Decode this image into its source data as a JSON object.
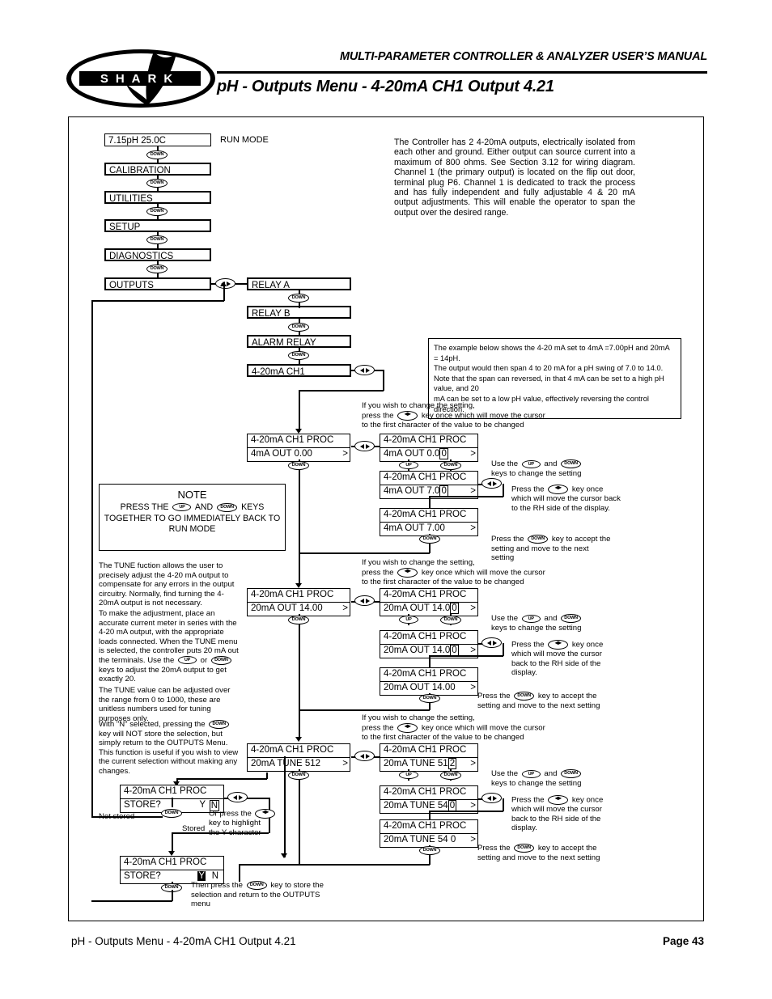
{
  "header": {
    "logo_text": "SHARK",
    "title": "MULTI-PARAMETER CONTROLLER & ANALYZER USER’S MANUAL",
    "subtitle": "pH - Outputs Menu - 4-20mA CH1 Output 4.21"
  },
  "footer": {
    "left": "pH - Outputs Menu - 4-20mA CH1 Output 4.21",
    "right": "Page 43"
  },
  "keys": {
    "down": "DOWN",
    "up": "UP",
    "leftright": "◄►"
  },
  "menu": {
    "run_mode_label": "RUN MODE",
    "items": [
      {
        "label": "7.15pH  25.0C"
      },
      {
        "label": "CALIBRATION"
      },
      {
        "label": "UTILITIES"
      },
      {
        "label": "SETUP"
      },
      {
        "label": "DIAGNOSTICS"
      },
      {
        "label": "OUTPUTS"
      }
    ]
  },
  "outputs_submenu": [
    {
      "label": "RELAY A"
    },
    {
      "label": "RELAY B"
    },
    {
      "label": "ALARM RELAY"
    },
    {
      "label": "4-20mA CH1"
    }
  ],
  "intro_text": "The Controller has 2 4-20mA outputs, electrically isolated from each other and ground. Either output can source current into a maximum of 800 ohms. See Section 3.12 for wiring diagram. Channel 1 (the primary output) is located on the flip out door, terminal plug P6. Channel 1 is dedicated to track the process and has fully independent and fully adjustable 4 & 20 mA output adjustments. This will enable the operator to span the output over the desired range.",
  "example_box": {
    "line1": "The example below shows the 4-20 mA set to 4mA =7.00pH and 20mA = 14pH.",
    "line2": "The output would then span 4 to 20 mA for a pH swing of 7.0 to 14.0.",
    "line3": "Note that the span can reversed, in that 4 mA can be set to a high pH value, and 20",
    "line4": "mA can be set to a low pH value, effectively reversing the control direction."
  },
  "note_box": {
    "title": "NOTE",
    "l1a": "PRESS THE",
    "l1b": "AND",
    "l1c": "KEYS",
    "l2": "TOGETHER TO GO IMMEDIATELY BACK TO",
    "l3": "RUN MODE"
  },
  "tune_text": {
    "p1": "The TUNE fuction allows the user to precisely adjust the 4-20 mA output to compensate for any errors in the output circuitry. Normally, find turning the 4-20mA output is not necessary.",
    "p2a": "To make the adjustment, place an accurate current meter in series with the 4-20 mA output, with the appropriate loads connected. When the TUNE menu is selected, the controller puts 20 mA out the terminals. Use the",
    "p2b": "or",
    "p2c": "keys to adjust the 20mA output to get exactly 20.",
    "p3": "The TUNE value can be adjusted over the range from 0 to 1000, these are unitless numbers used for tuning purposes only.",
    "p4a": "With \"N\" selected, pressing the",
    "p4b": "key will NOT store the selection, but simply return to the OUTPUTS Menu. This function is useful if you wish to view the current selection without making any changes."
  },
  "change_hint": {
    "l1": "If you wish to change the setting,",
    "l2a": "press the",
    "l2b": "key once which will move the cursor",
    "l3": "to the first character of the value to be changed"
  },
  "use_updown_hint": {
    "a": "Use the",
    "b": "and",
    "c": "keys to change the setting"
  },
  "press_lr_hint": {
    "a": "Press the",
    "b": "key once",
    "l2": "which will move the cursor back",
    "l3": "to the RH side of the display."
  },
  "press_lr_hint_b": {
    "a": "Press the",
    "b": "key once",
    "l2": "which will move the cursor",
    "l3": "back to the RH side of the",
    "l4": "display."
  },
  "accept_hint": {
    "a": "Press the",
    "b": "key to accept the",
    "l2": "setting and move to the next",
    "l3": "setting"
  },
  "accept_hint_b": {
    "a": "Press the",
    "b": "key to accept the",
    "l2": "setting and move to the next setting"
  },
  "sequences": {
    "ma4": {
      "main": {
        "t": "4-20mA CH1 PROC",
        "v": "4mA OUT  0.00"
      },
      "edit1": {
        "t": "4-20mA CH1 PROC",
        "v_pre": "4mA  OUT   0.0",
        "v_cur": "0"
      },
      "edit2": {
        "t": "4-20mA CH1 PROC",
        "v_pre": "4mA  OUT   7.0",
        "v_cur": "0"
      },
      "done": {
        "t": "4-20mA CH1 PROC",
        "v": "4mA  OUT   7.00"
      }
    },
    "ma20": {
      "main": {
        "t": "4-20mA CH1 PROC",
        "v": "20mA OUT 14.00"
      },
      "edit1": {
        "t": "4-20mA CH1 PROC",
        "v_pre": "20mA  OUT  14.0",
        "v_cur": "0"
      },
      "edit2": {
        "t": "4-20mA CH1 PROC",
        "v_pre": "20mA  OUT  14.0",
        "v_cur": "0"
      },
      "done": {
        "t": "4-20mA CH1 PROC",
        "v": "20mA  OUT  14.00"
      }
    },
    "tune": {
      "main": {
        "t": "4-20mA CH1 PROC",
        "v": "20mA TUNE 512"
      },
      "edit1": {
        "t": "4-20mA CH1 PROC",
        "v_pre": "20mA  TUNE 51",
        "v_cur": "2"
      },
      "edit2": {
        "t": "4-20mA CH1 PROC",
        "v_pre": "20mA  TUNE 54",
        "v_cur": "0"
      },
      "done": {
        "t": "4-20mA CH1 PROC",
        "v": "20mA  TUNE 54 0"
      }
    },
    "store": {
      "n": {
        "t": "4-20mA CH1 PROC",
        "label": "STORE?",
        "y": "Y",
        "n": "N"
      },
      "y": {
        "t": "4-20mA CH1 PROC",
        "label": "STORE?",
        "y": "Y",
        "n": "N"
      }
    }
  },
  "store_hints": {
    "not_stored": "Not stored",
    "stored": "Stored",
    "or_press_a": "Or press the",
    "or_press_b": "key to highlight",
    "or_press_c": "the Y character",
    "final_a": "Then press the",
    "final_b": "key to store the",
    "final_l2": "selection and return to the OUTPUTS",
    "final_l3": "menu"
  }
}
